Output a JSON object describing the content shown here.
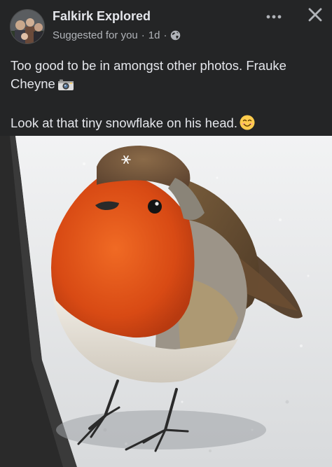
{
  "post": {
    "author": "Falkirk Explored",
    "suggestion": "Suggested for you",
    "separator": "·",
    "time": "1d",
    "line1": "Too good to be in amongst other photos. Frauke",
    "line2": "Cheyne",
    "line3": "Look at that tiny snowflake on his head.",
    "icons": {
      "audience": "globe-icon",
      "more": "more-options-icon",
      "close": "close-icon",
      "camera": "camera-emoji",
      "smile": "smiling-face-emoji"
    },
    "image": {
      "subject": "robin",
      "colors": {
        "breast": "#e0541a",
        "head": "#7a5a3a",
        "snow": "#e6e8ea",
        "background": "#9a9a9a"
      }
    }
  }
}
